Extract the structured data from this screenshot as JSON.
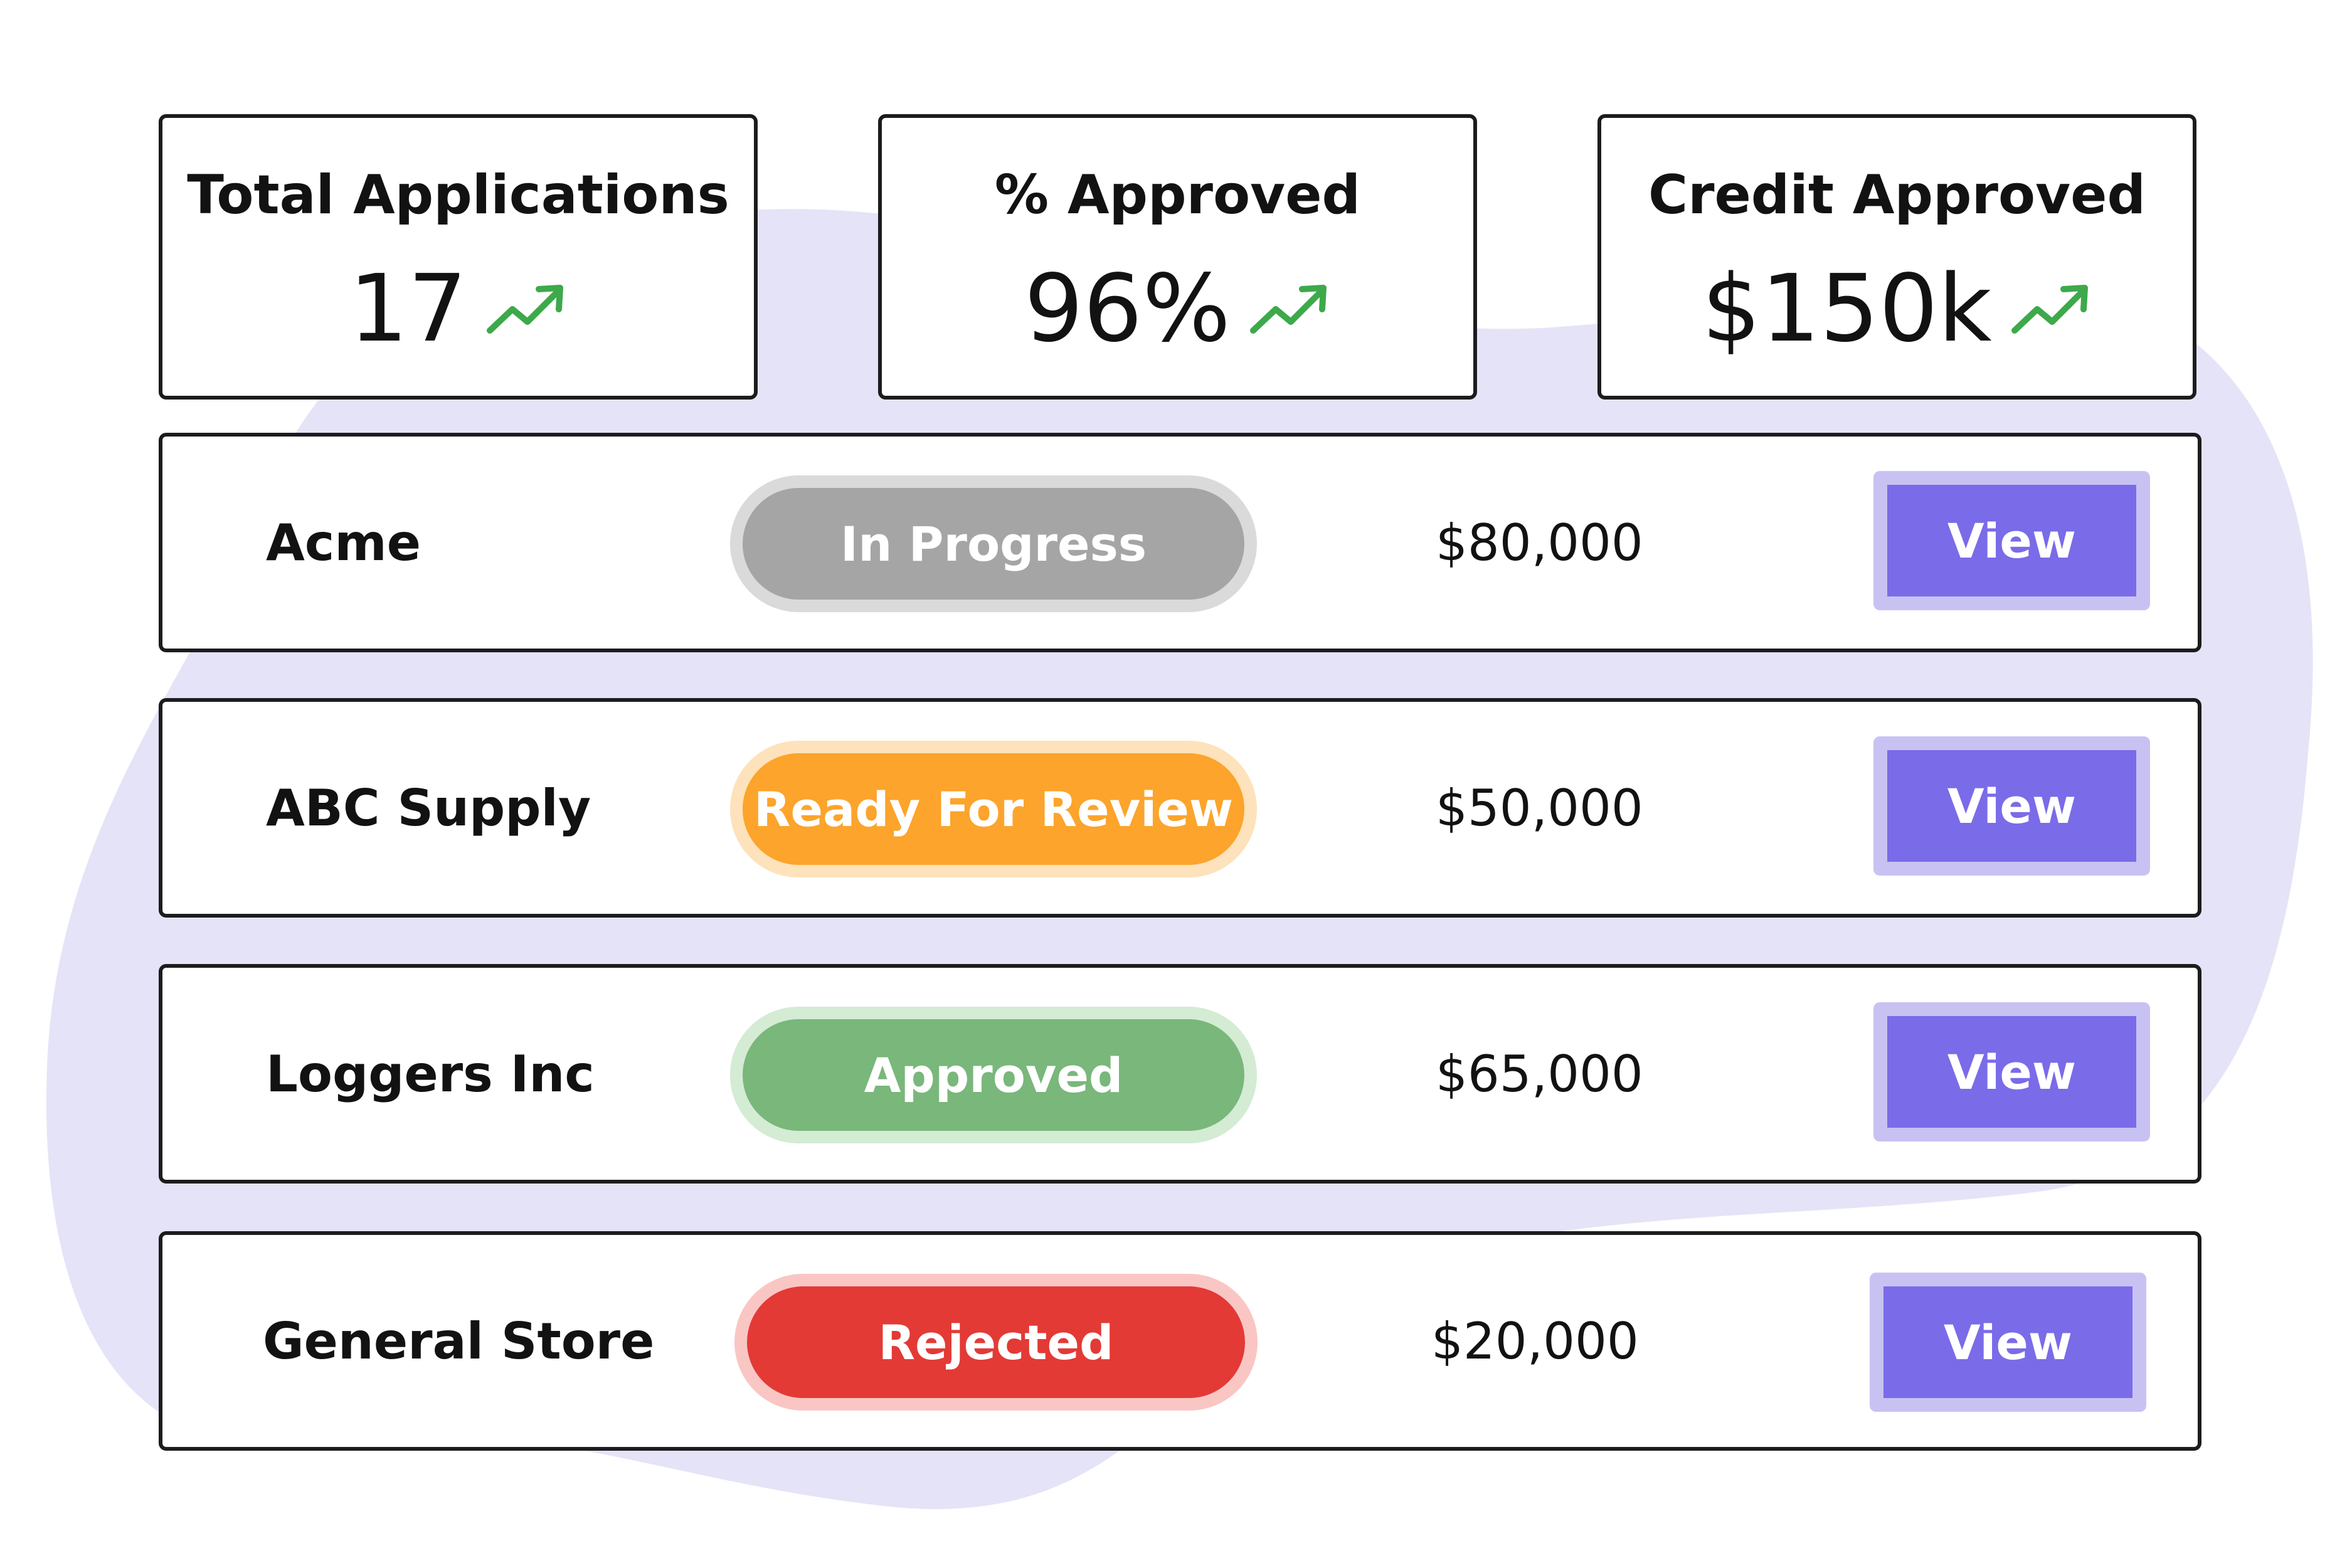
{
  "colors": {
    "background_blob": "#e5e3f7",
    "trend": "#3da94b",
    "view_button": "#7a6be8",
    "view_button_border": "#c8c2f3",
    "in_progress": "#a5a5a5",
    "ready_for_review": "#fca42b",
    "approved": "#79b77b",
    "rejected": "#e33a36"
  },
  "stats": [
    {
      "title": "Total Applications",
      "value": "17",
      "icon": "trending-up-icon"
    },
    {
      "title": "% Approved",
      "value": "96%",
      "icon": "trending-up-icon"
    },
    {
      "title": "Credit Approved",
      "value": "$150k",
      "icon": "trending-up-icon"
    }
  ],
  "applications": [
    {
      "company": "Acme",
      "status": "In Progress",
      "amount": "$80,000",
      "action": "View"
    },
    {
      "company": "ABC Supply",
      "status": "Ready For Review",
      "amount": "$50,000",
      "action": "View"
    },
    {
      "company": "Loggers Inc",
      "status": "Approved",
      "amount": "$65,000",
      "action": "View"
    },
    {
      "company": "General Store",
      "status": "Rejected",
      "amount": "$20,000",
      "action": "View"
    }
  ]
}
